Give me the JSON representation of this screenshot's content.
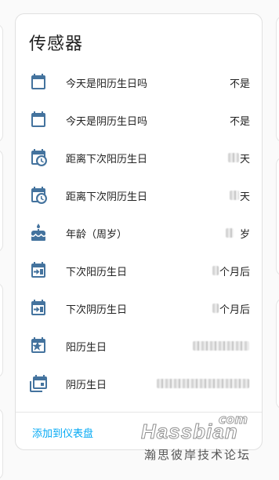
{
  "card": {
    "title": "传感器",
    "rows": [
      {
        "icon": "calendar-blank-icon",
        "label": "今天是阳历生日吗",
        "value": "不是"
      },
      {
        "icon": "calendar-blank-icon",
        "label": "今天是阴历生日吗",
        "value": "不是"
      },
      {
        "icon": "calendar-clock-icon",
        "label": "距离下次阳历生日",
        "value": "天"
      },
      {
        "icon": "calendar-clock-icon",
        "label": "距离下次阴历生日",
        "value": "天"
      },
      {
        "icon": "cake-icon",
        "label": "年龄（周岁）",
        "value": "岁"
      },
      {
        "icon": "calendar-arrow-right-icon",
        "label": "下次阳历生日",
        "value": "个月后"
      },
      {
        "icon": "calendar-arrow-right-icon",
        "label": "下次阴历生日",
        "value": "个月后"
      },
      {
        "icon": "calendar-star-icon",
        "label": "阳历生日",
        "value": ""
      },
      {
        "icon": "calendar-multiple-icon",
        "label": "阴历生日",
        "value": ""
      }
    ],
    "add_to_dashboard": "添加到仪表盘"
  },
  "watermark": {
    "brand": "Hassbian",
    "tld": "com",
    "subtitle": "瀚思彼岸技术论坛"
  },
  "colors": {
    "icon": "#44739e",
    "link": "#03a9f4",
    "text": "#212121"
  }
}
